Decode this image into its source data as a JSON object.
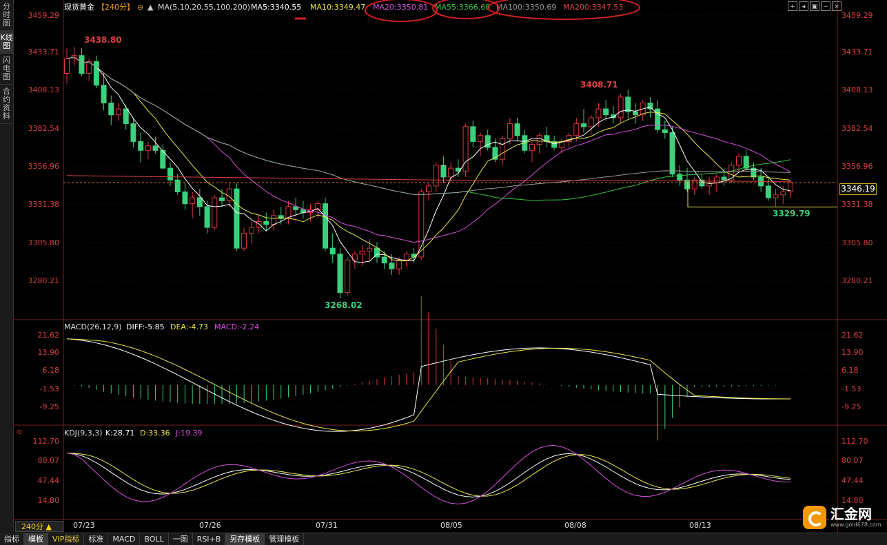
{
  "left_tabs": [
    "分时图",
    "K线图",
    "闪电图",
    "合约资料"
  ],
  "header": {
    "symbol": "现货黄金",
    "period": "【240分】",
    "ma_params": "MA(5,10,20,55,100,200)",
    "ma_values": [
      {
        "label": "MA5:3340.55",
        "color": "#ffffff"
      },
      {
        "label": "MA10:3349.47",
        "color": "#e8e84a"
      },
      {
        "label": "MA20:3350.81",
        "color": "#d94fe0"
      },
      {
        "label": "MA55:3366.60",
        "color": "#39c83c"
      },
      {
        "label": "MA100:3350.69",
        "color": "#9a9a9a"
      },
      {
        "label": "MA200:3347.53",
        "color": "#e04040"
      }
    ]
  },
  "toolbar_icons": [
    "plus-icon",
    "left-icon",
    "box-icon",
    "minus-icon",
    "close-icon"
  ],
  "price_axis": {
    "ticks": [
      "3459.29",
      "3433.71",
      "3408.13",
      "3382.54",
      "3356.96",
      "3331.38",
      "3305.80",
      "3280.21"
    ],
    "current": "3346.19"
  },
  "annotations": {
    "high": "3438.80",
    "mid_high": "3408.71",
    "low": "3268.02",
    "recent_low": "3329.79"
  },
  "macd": {
    "title": "MACD(26,12,9)",
    "diff": "DIFF:-5.85",
    "dea": "DEA:-4.73",
    "macd": "MACD:-2.24",
    "ticks": [
      "21.62",
      "13.90",
      "6.18",
      "-1.53",
      "-9.25"
    ]
  },
  "kdj": {
    "title": "KDJ(9,3,3)",
    "k": "K:28.71",
    "d": "D:33.36",
    "j": "J:19.39",
    "ticks": [
      "112.70",
      "80.07",
      "47.44",
      "14.80"
    ]
  },
  "period_box": "240分 ▲",
  "date_labels": [
    "07/23",
    "07/26",
    "07/31",
    "08/05",
    "08/08",
    "08/13"
  ],
  "bottom_tabs": [
    "指标",
    "模板",
    "VIP指标",
    "标准",
    "MACD",
    "BOLL",
    "一图",
    "RSI+B",
    "另存模板",
    "管理模板"
  ],
  "logo": {
    "name": "汇金网",
    "url": "www.gold678.com"
  },
  "colors": {
    "up": "#e0393e",
    "down": "#3bd17c",
    "ma5": "#ffffff",
    "ma10": "#e8e84a",
    "ma20": "#d94fe0",
    "ma55": "#39c83c",
    "ma200": "#e04040",
    "circle": "#d02020"
  }
}
